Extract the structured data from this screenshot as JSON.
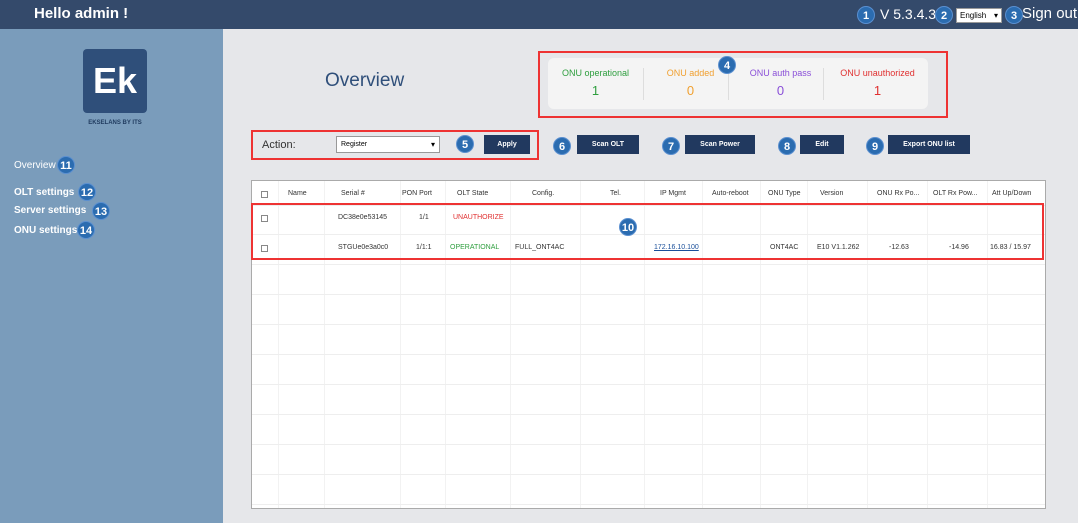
{
  "header": {
    "greeting": "Hello admin !",
    "version": "V 5.3.4.3",
    "language": "English",
    "sign_out": "Sign out"
  },
  "badges": [
    "1",
    "2",
    "3",
    "4",
    "5",
    "6",
    "7",
    "8",
    "9",
    "10",
    "11",
    "12",
    "13",
    "14"
  ],
  "sidebar": {
    "logo_text": "Ek",
    "logo_caption": "EKSELANS BY ITS",
    "items": [
      {
        "label": "Overview"
      },
      {
        "label": "OLT settings"
      },
      {
        "label": "Server settings"
      },
      {
        "label": "ONU settings"
      }
    ]
  },
  "page": {
    "title": "Overview"
  },
  "stats": [
    {
      "label": "ONU operational",
      "value": "1",
      "color": "#2e9e3e"
    },
    {
      "label": "ONU added",
      "value": "0",
      "color": "#f0a030"
    },
    {
      "label": "ONU auth pass",
      "value": "0",
      "color": "#8a4fd8"
    },
    {
      "label": "ONU unauthorized",
      "value": "1",
      "color": "#e03030"
    }
  ],
  "actions": {
    "label": "Action:",
    "selected": "Register",
    "apply": "Apply",
    "scan_olt": "Scan OLT",
    "scan_power": "Scan Power",
    "edit": "Edit",
    "export": "Export ONU list"
  },
  "table": {
    "headers": [
      "Name",
      "Serial #",
      "PON Port",
      "OLT State",
      "Config.",
      "Tel.",
      "IP Mgmt",
      "Auto-reboot",
      "ONU Type",
      "Version",
      "ONU Rx Po...",
      "OLT Rx Pow...",
      "Att Up/Down"
    ],
    "rows": [
      {
        "name": "",
        "serial": "DC38e0e53145",
        "pon": "1/1",
        "state": "UNAUTHORIZE",
        "config": "",
        "tel": "",
        "ip": "",
        "reboot": "",
        "type": "",
        "version": "",
        "onu_rx": "",
        "olt_rx": "",
        "att": ""
      },
      {
        "name": "",
        "serial": "STGUe0e3a0c0",
        "pon": "1/1:1",
        "state": "OPERATIONAL",
        "config": "FULL_ONT4AC",
        "tel": "",
        "ip": "172.16.10.100",
        "reboot": "",
        "type": "ONT4AC",
        "version": "E10 V1.1.262",
        "onu_rx": "-12.63",
        "olt_rx": "-14.96",
        "att": "16.83 / 15.97"
      }
    ]
  },
  "colors": {
    "topbar": "#344a6b",
    "sidebar": "#7a9cbb",
    "button": "#21395f",
    "badge": "#2b6cb0",
    "highlight": "#e33333",
    "unauthorized": "#e03030",
    "operational": "#2e9e3e"
  }
}
